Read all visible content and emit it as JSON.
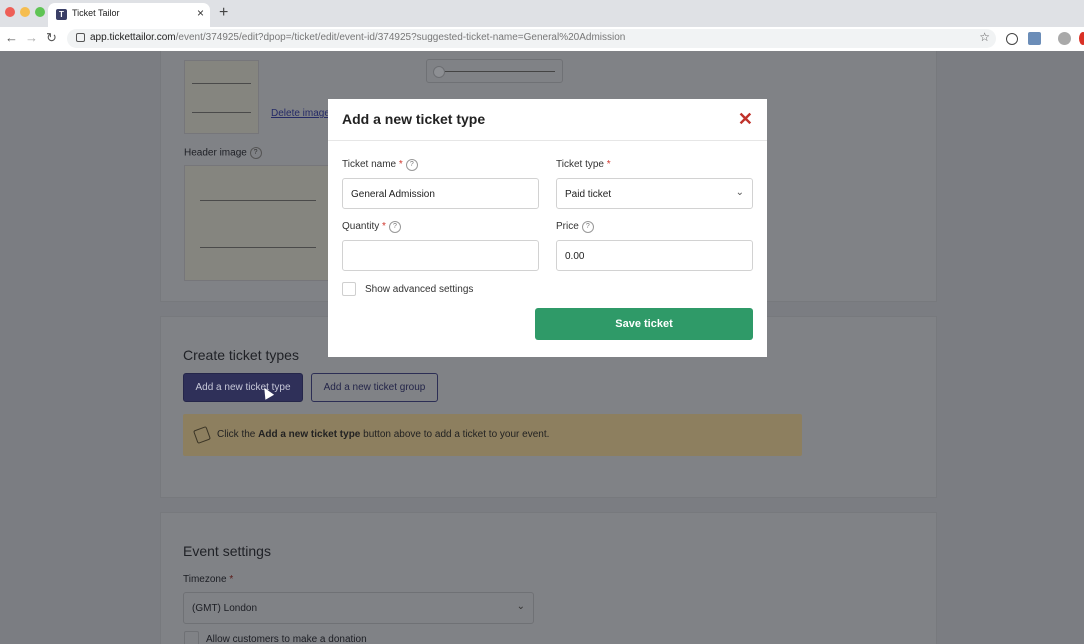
{
  "browser": {
    "tab_title": "Ticket Tailor",
    "url_host": "app.tickettailor.com",
    "url_path": "/event/374925/edit?dpop=/ticket/edit/event-id/374925?suggested-ticket-name=General%20Admission",
    "favicon_letter": "T",
    "traffic_colors": [
      "#ee5f57",
      "#f5bd4f",
      "#5fc454"
    ]
  },
  "background": {
    "image_section": {
      "delete_image": "Delete image",
      "header_image_label": "Header image",
      "help_mark": "?"
    },
    "create_ticket_types": {
      "title": "Create ticket types",
      "add_ticket_type": "Add a new ticket type",
      "add_ticket_group": "Add a new ticket group",
      "notice_prefix": "Click the ",
      "notice_bold": "Add a new ticket type",
      "notice_suffix": " button above to add a ticket to your event."
    },
    "event_settings": {
      "title": "Event settings",
      "timezone_label": "Timezone",
      "timezone_value": "(GMT) London",
      "donation_label": "Allow customers to make a donation"
    }
  },
  "modal": {
    "title": "Add a new ticket type",
    "close_glyph": "✕",
    "ticket_name_label": "Ticket name",
    "ticket_name_value": "General Admission",
    "ticket_type_label": "Ticket type",
    "ticket_type_value": "Paid ticket",
    "quantity_label": "Quantity",
    "quantity_value": "",
    "price_label": "Price",
    "price_value": "0.00",
    "advanced_label": "Show advanced settings",
    "save_label": "Save ticket",
    "required_mark": "*",
    "help_mark": "?",
    "save_color": "#2f9a68",
    "close_color": "#c0322b"
  }
}
